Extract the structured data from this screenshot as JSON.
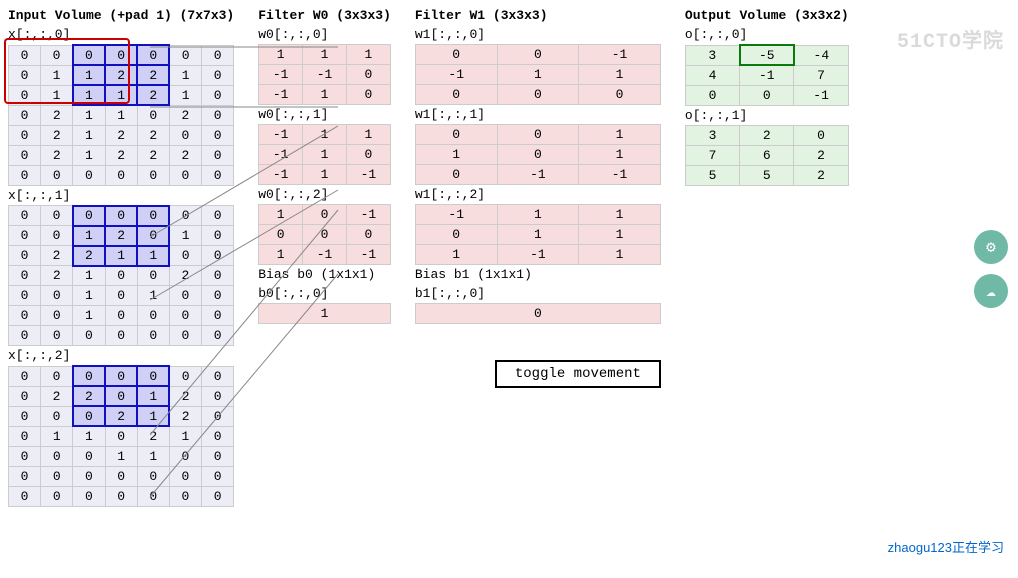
{
  "watermark": "51CTO学院",
  "learning_note": "zhaogu123正在学习",
  "toggle_label": "toggle movement",
  "input": {
    "title": "Input Volume (+pad 1) (7x7x3)",
    "slices": [
      {
        "label": "x[:,:,0]",
        "rows": [
          [
            0,
            0,
            0,
            0,
            0,
            0,
            0
          ],
          [
            0,
            1,
            1,
            2,
            2,
            1,
            0
          ],
          [
            0,
            1,
            1,
            1,
            2,
            1,
            0
          ],
          [
            0,
            2,
            1,
            1,
            0,
            2,
            0
          ],
          [
            0,
            2,
            1,
            2,
            2,
            0,
            0
          ],
          [
            0,
            2,
            1,
            2,
            2,
            2,
            0
          ],
          [
            0,
            0,
            0,
            0,
            0,
            0,
            0
          ]
        ],
        "hl_row_start": 0,
        "hl_row_end": 2,
        "hl_col_start": 2,
        "hl_col_end": 4
      },
      {
        "label": "x[:,:,1]",
        "rows": [
          [
            0,
            0,
            0,
            0,
            0,
            0,
            0
          ],
          [
            0,
            0,
            1,
            2,
            0,
            1,
            0
          ],
          [
            0,
            2,
            2,
            1,
            1,
            0,
            0
          ],
          [
            0,
            2,
            1,
            0,
            0,
            2,
            0
          ],
          [
            0,
            0,
            1,
            0,
            1,
            0,
            0
          ],
          [
            0,
            0,
            1,
            0,
            0,
            0,
            0
          ],
          [
            0,
            0,
            0,
            0,
            0,
            0,
            0
          ]
        ],
        "hl_row_start": 0,
        "hl_row_end": 2,
        "hl_col_start": 2,
        "hl_col_end": 4
      },
      {
        "label": "x[:,:,2]",
        "rows": [
          [
            0,
            0,
            0,
            0,
            0,
            0,
            0
          ],
          [
            0,
            2,
            2,
            0,
            1,
            2,
            0
          ],
          [
            0,
            0,
            0,
            2,
            1,
            2,
            0
          ],
          [
            0,
            1,
            1,
            0,
            2,
            1,
            0
          ],
          [
            0,
            0,
            0,
            1,
            1,
            0,
            0
          ],
          [
            0,
            0,
            0,
            0,
            0,
            0,
            0
          ],
          [
            0,
            0,
            0,
            0,
            0,
            0,
            0
          ]
        ],
        "hl_row_start": 0,
        "hl_row_end": 2,
        "hl_col_start": 2,
        "hl_col_end": 4
      }
    ]
  },
  "w0": {
    "title": "Filter W0 (3x3x3)",
    "slices": [
      {
        "label": "w0[:,:,0]",
        "rows": [
          [
            1,
            1,
            1
          ],
          [
            -1,
            -1,
            0
          ],
          [
            -1,
            1,
            0
          ]
        ]
      },
      {
        "label": "w0[:,:,1]",
        "rows": [
          [
            -1,
            1,
            1
          ],
          [
            -1,
            1,
            0
          ],
          [
            -1,
            1,
            -1
          ]
        ]
      },
      {
        "label": "w0[:,:,2]",
        "rows": [
          [
            1,
            0,
            -1
          ],
          [
            0,
            0,
            0
          ],
          [
            1,
            -1,
            -1
          ]
        ]
      }
    ],
    "bias_title": "Bias b0 (1x1x1)",
    "bias_label": "b0[:,:,0]",
    "bias_val": 1
  },
  "w1": {
    "title": "Filter W1 (3x3x3)",
    "slices": [
      {
        "label": "w1[:,:,0]",
        "rows": [
          [
            0,
            0,
            -1
          ],
          [
            -1,
            1,
            1
          ],
          [
            0,
            0,
            0
          ]
        ]
      },
      {
        "label": "w1[:,:,1]",
        "rows": [
          [
            0,
            0,
            1
          ],
          [
            1,
            0,
            1
          ],
          [
            0,
            -1,
            -1
          ]
        ]
      },
      {
        "label": "w1[:,:,2]",
        "rows": [
          [
            -1,
            1,
            1
          ],
          [
            0,
            1,
            1
          ],
          [
            1,
            -1,
            1
          ]
        ]
      }
    ],
    "bias_title": "Bias b1 (1x1x1)",
    "bias_label": "b1[:,:,0]",
    "bias_val": 0
  },
  "output": {
    "title": "Output Volume (3x3x2)",
    "slices": [
      {
        "label": "o[:,:,0]",
        "rows": [
          [
            3,
            -5,
            -4
          ],
          [
            4,
            -1,
            7
          ],
          [
            0,
            0,
            -1
          ]
        ],
        "cur_r": 0,
        "cur_c": 1
      },
      {
        "label": "o[:,:,1]",
        "rows": [
          [
            3,
            2,
            0
          ],
          [
            7,
            6,
            2
          ],
          [
            5,
            5,
            2
          ]
        ]
      }
    ]
  }
}
